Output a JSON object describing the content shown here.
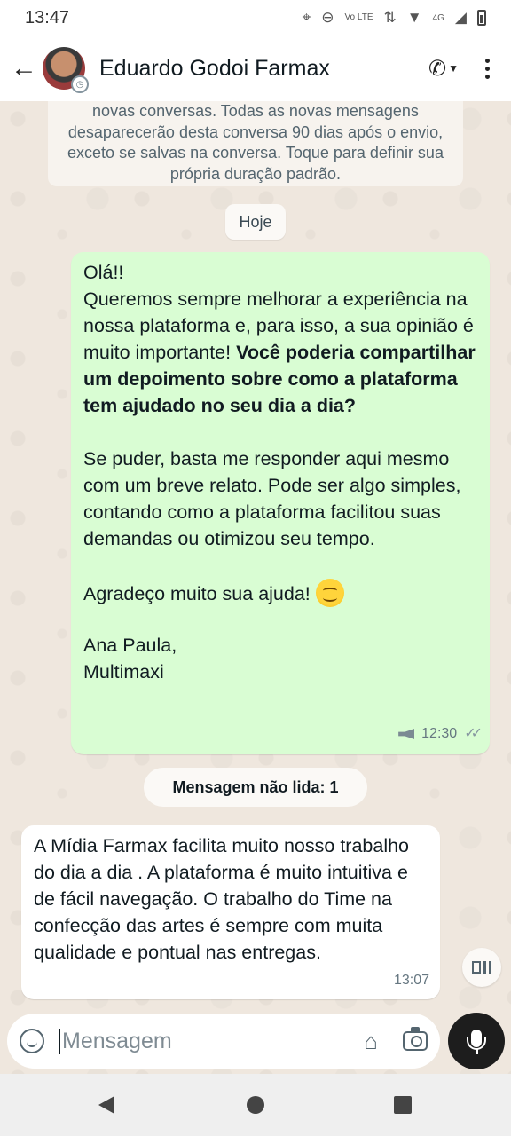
{
  "status_bar": {
    "time": "13:47",
    "network_label": "Vo\nLTE",
    "signal_label": "4G"
  },
  "header": {
    "contact_name": "Eduardo Godoi Farmax"
  },
  "notice": {
    "text": "novas conversas. Todas as novas mensagens desaparecerão desta conversa 90 dias após o envio, exceto se salvas na conversa. Toque para definir sua própria duração padrão."
  },
  "date_label": "Hoje",
  "outgoing_message": {
    "line1": "Olá!!\nQueremos sempre melhorar a experiência na nossa plataforma e, para isso, a sua opinião é muito importante! ",
    "bold": "Você poderia compartilhar um depoimento sobre como a plataforma tem ajudado no seu dia a dia?",
    "paragraph2": "Se puder, basta me responder aqui mesmo com um breve relato. Pode ser algo simples, contando como a plataforma facilitou suas demandas ou otimizou seu tempo.",
    "paragraph3": "Agradeço muito sua ajuda!",
    "signature": "Ana Paula,\nMultimaxi",
    "time": "12:30"
  },
  "unread_label": "Mensagem não lida: 1",
  "incoming_message": {
    "text": "A Mídia Farmax facilita muito nosso trabalho do dia a dia . A plataforma é muito intuitiva e de fácil navegação. O trabalho do Time na confecção das artes é sempre com muita  qualidade e pontual nas entregas.",
    "time": "13:07"
  },
  "composer": {
    "placeholder": "Mensagem"
  },
  "colors": {
    "outgoing_bubble": "#d9fdd3",
    "incoming_bubble": "#ffffff",
    "wallpaper": "#efe7de",
    "mic_button": "#1d1d1d"
  }
}
